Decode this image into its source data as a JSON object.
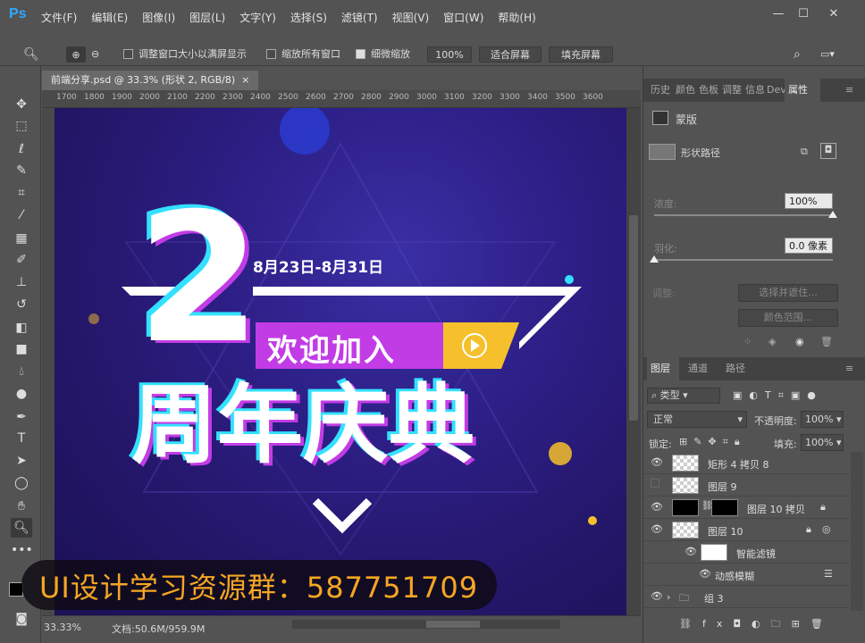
{
  "app": {
    "logo": "Ps"
  },
  "menu": [
    "文件(F)",
    "编辑(E)",
    "图像(I)",
    "图层(L)",
    "文字(Y)",
    "选择(S)",
    "滤镜(T)",
    "视图(V)",
    "窗口(W)",
    "帮助(H)"
  ],
  "window_controls": {
    "minimize": "—",
    "maximize": "☐",
    "close": "✕"
  },
  "options_bar": {
    "zoom_icon": "zoom-icon",
    "resize_windows_label": "调整窗口大小以满屏显示",
    "resize_windows_checked": false,
    "zoom_all_label": "缩放所有窗口",
    "zoom_all_checked": false,
    "scrubby_label": "细微缩放",
    "scrubby_checked": true,
    "percent_button": "100%",
    "fit_screen_button": "适合屏幕",
    "fill_screen_button": "填充屏幕"
  },
  "document": {
    "tab_title": "前端分享.psd @ 33.3% (形状 2, RGB/8)",
    "tab_close": "×",
    "ruler_ticks": [
      "1700",
      "1800",
      "1900",
      "2000",
      "2100",
      "2200",
      "2300",
      "2400",
      "2500",
      "2600",
      "2700",
      "2800",
      "2900",
      "3000",
      "3100",
      "3200",
      "3300",
      "3400",
      "3500",
      "3600"
    ],
    "zoom_level": "33.33%",
    "doc_size": "文档:50.6M/959.9M"
  },
  "artwork": {
    "big_number": "2",
    "date_range": "8月23日-8月31日",
    "welcome": "欢迎加入",
    "title": "周年庆典",
    "colors": {
      "bg_dark": "#1a1155",
      "bg_mid": "#2d1f86",
      "magenta": "#c23ce6",
      "yellow": "#f5c02b",
      "cyan": "#33e0ff",
      "white": "#ffffff"
    }
  },
  "promo": {
    "text": "UI设计学习资源群：587751709"
  },
  "properties_panel": {
    "tabs": [
      "历史",
      "颜色",
      "色板",
      "调整",
      "信息",
      "Dev",
      "属性"
    ],
    "active_tab": "属性",
    "mask_label": "蒙版",
    "shape_path_label": "形状路径",
    "density_label": "浓度:",
    "density_value": "100%",
    "density_fraction": 1.0,
    "feather_label": "羽化:",
    "feather_value": "0.0 像素",
    "feather_fraction": 0.0,
    "adjust_label": "调整:",
    "select_mask_button": "选择并遮住...",
    "color_range_button": "颜色范围..."
  },
  "layers_panel": {
    "tabs": [
      "图层",
      "通道",
      "路径"
    ],
    "active_tab": "图层",
    "kind_filter": "类型",
    "blend_mode": "正常",
    "opacity_label": "不透明度:",
    "opacity_value": "100%",
    "lock_label": "锁定:",
    "fill_label": "填充:",
    "fill_value": "100%",
    "layers": [
      {
        "name": "矩形 4 拷贝 8",
        "visible": true
      },
      {
        "name": "图层 9",
        "visible": false
      },
      {
        "name": "图层 10 拷贝",
        "visible": true
      },
      {
        "name": "图层 10",
        "visible": true
      },
      {
        "name": "智能滤镜",
        "visible": true
      },
      {
        "name": "动感模糊",
        "visible": true
      },
      {
        "name": "组 3",
        "visible": true
      }
    ]
  }
}
